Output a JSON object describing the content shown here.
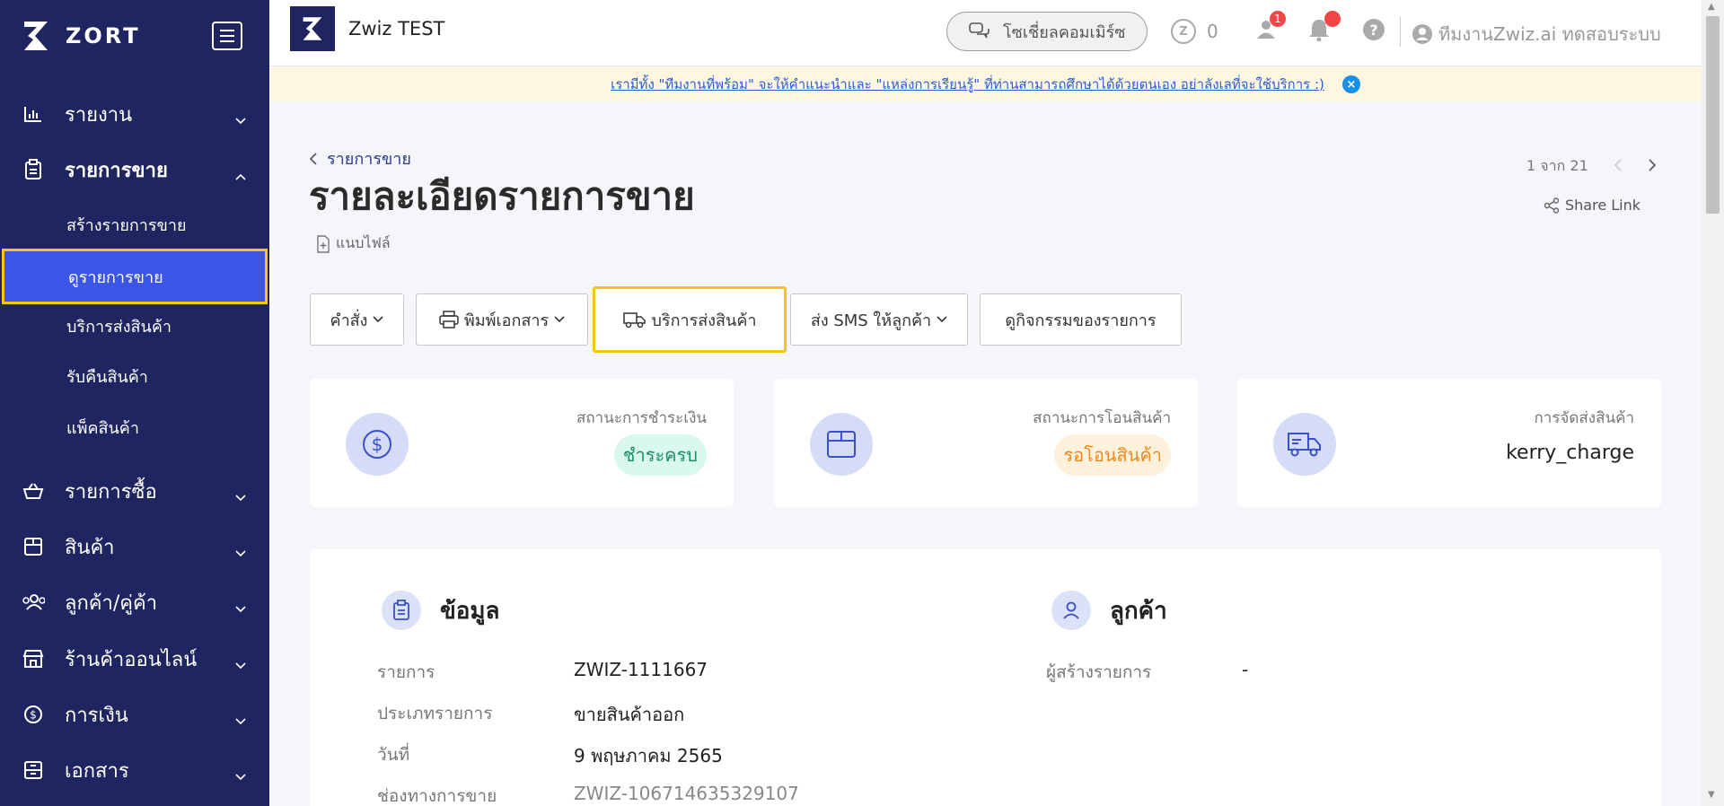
{
  "sidebar": {
    "brand": "ZORT",
    "nav": [
      {
        "label": "รายงาน"
      },
      {
        "label": "รายการขาย"
      },
      {
        "label": "รายการซื้อ"
      },
      {
        "label": "สินค้า"
      },
      {
        "label": "ลูกค้า/คู่ค้า"
      },
      {
        "label": "ร้านค้าออนไลน์"
      },
      {
        "label": "การเงิน"
      },
      {
        "label": "เอกสาร"
      }
    ],
    "sub": [
      {
        "label": "สร้างรายการขาย"
      },
      {
        "label": "ดูรายการขาย"
      },
      {
        "label": "บริการส่งสินค้า"
      },
      {
        "label": "รับคืนสินค้า"
      },
      {
        "label": "แพ็คสินค้า"
      }
    ]
  },
  "header": {
    "workspace": "Zwiz TEST",
    "social_commerce": "โซเชี่ยลคอมเมิร์ซ",
    "coins": "0",
    "user_badge": "1",
    "user_name": "ทีมงานZwiz.ai ทดสอบระบบ"
  },
  "banner": {
    "text": "เรามีทั้ง \"ทีมงานที่พร้อม\" จะให้คำแนะนำและ \"แหล่งการเรียนรู้\" ที่ท่านสามารถศึกษาได้ด้วยตนเอง อย่าลังเลที่จะใช้บริการ :)",
    "close": "×"
  },
  "page": {
    "breadcrumb": "รายการขาย",
    "title": "รายละเอียดรายการขาย",
    "attach": "แนบไฟล์",
    "pager": "1 จาก 21",
    "share": "Share Link"
  },
  "actions": {
    "command": "คำสั่ง",
    "print": "พิมพ์เอกสาร",
    "shipping": "บริการส่งสินค้า",
    "sms": "ส่ง SMS ให้ลูกค้า",
    "activity": "ดูกิจกรรมของรายการ"
  },
  "stats": {
    "payment_label": "สถานะการชำระเงิน",
    "payment_value": "ชำระครบ",
    "transfer_label": "สถานะการโอนสินค้า",
    "transfer_value": "รอโอนสินค้า",
    "delivery_label": "การจัดส่งสินค้า",
    "delivery_value": "kerry_charge"
  },
  "info": {
    "title": "ข้อมูล",
    "rows": [
      {
        "label": "รายการ",
        "value": "ZWIZ-1111667"
      },
      {
        "label": "ประเภทรายการ",
        "value": "ขายสินค้าออก"
      },
      {
        "label": "วันที่",
        "value": "9 พฤษภาคม 2565"
      },
      {
        "label": "ช่องทางการขาย",
        "value": "ZWIZ-106714635329107"
      }
    ]
  },
  "customer": {
    "title": "ลูกค้า",
    "creator_label": "ผู้สร้างรายการ",
    "creator_value": "-"
  },
  "colors": {
    "sidebar": "#1e2561",
    "active": "#3b55e6",
    "highlight": "#f5c518",
    "paid": "#1a8f62",
    "pending": "#ef8a1e"
  }
}
